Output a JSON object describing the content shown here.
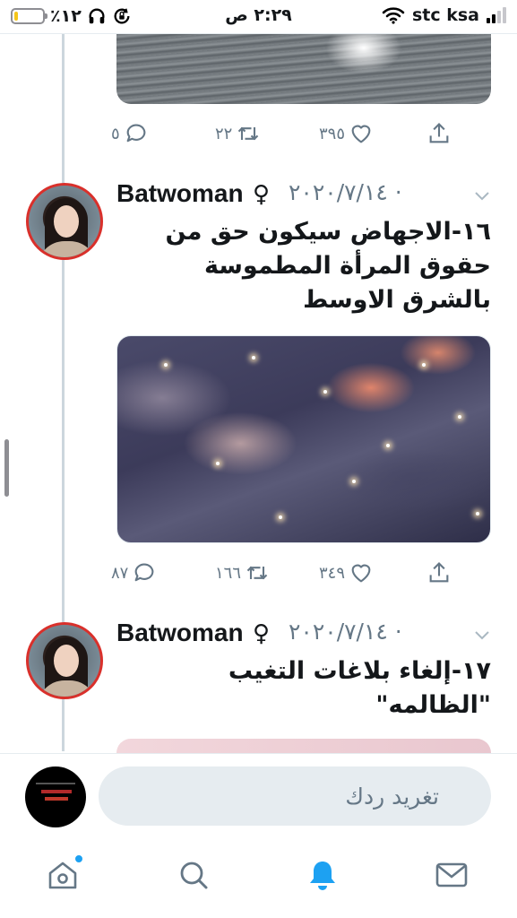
{
  "status_bar": {
    "battery_percent": "٪١٢",
    "battery_level": 0.12,
    "time": "٢:٢٩ ص",
    "carrier": "stc ksa",
    "icons": [
      "battery-icon",
      "headphones-icon",
      "orientation-lock-icon",
      "wifi-icon",
      "signal-bars-icon"
    ]
  },
  "colors": {
    "accent": "#1da1f2",
    "text_primary": "#14171a",
    "text_secondary": "#657786",
    "battery_fill": "#f5c518",
    "avatar_ring": "#d9302b"
  },
  "tweets": [
    {
      "media": "sea-image",
      "actions": {
        "reply_count": "٥",
        "retweet_count": "٢٢",
        "like_count": "٣٩٥"
      }
    },
    {
      "username": "Batwoman",
      "symbol": "♀",
      "date": "٢٠٢٠/٧/١٤ ·",
      "text": "١٦-الاجهاض سيكون حق من حقوق المرأة المطموسة بالشرق الاوسط",
      "media": "night-sky-image",
      "actions": {
        "reply_count": "٨٧",
        "retweet_count": "١٦٦",
        "like_count": "٣٤٩"
      }
    },
    {
      "username": "Batwoman",
      "symbol": "♀",
      "date": "٢٠٢٠/٧/١٤ ·",
      "text": "١٧-إلغاء بلاغات التغيب \"الظالمه\"",
      "media": "pink-image"
    }
  ],
  "composer": {
    "placeholder": "تغريد ردك"
  },
  "bottom_nav": {
    "items": [
      {
        "name": "home",
        "icon": "home-icon",
        "has_dot": true
      },
      {
        "name": "search",
        "icon": "search-icon"
      },
      {
        "name": "notifications",
        "icon": "bell-icon",
        "active": true
      },
      {
        "name": "messages",
        "icon": "mail-icon"
      }
    ]
  }
}
